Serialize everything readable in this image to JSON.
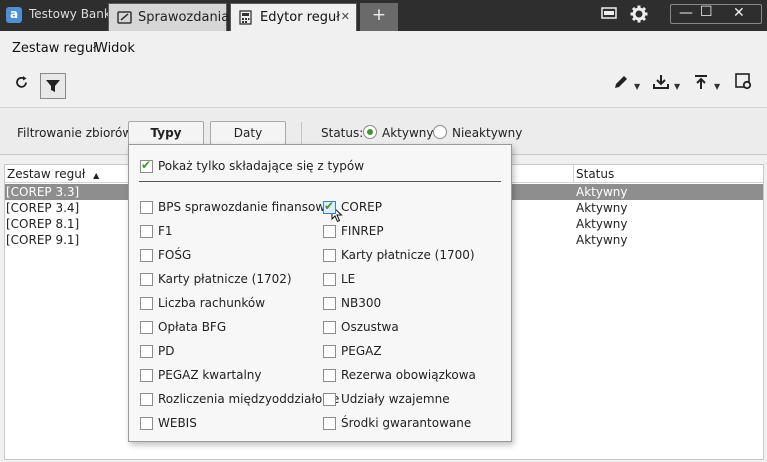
{
  "titlebar": {
    "app_name": "Testowy Bank",
    "tabs": [
      {
        "label": "Sprawozdania",
        "icon": "briefcase-icon"
      },
      {
        "label": "Edytor reguł",
        "icon": "calculator-icon",
        "close": "✕"
      }
    ],
    "add_tab": "+",
    "window_controls": {
      "minimize": "—",
      "maximize": "☐",
      "close": "✕"
    }
  },
  "menu": {
    "items": [
      "Zestaw reguł",
      "Widok"
    ]
  },
  "filterbar": {
    "label": "Filtrowanie zbiorów",
    "btn_types": "Typy",
    "btn_dates": "Daty",
    "status_label": "Status:",
    "status_active": "Aktywny",
    "status_inactive": "Nieaktywny",
    "status_selected": "Aktywny"
  },
  "table": {
    "headers": {
      "ruleset": "Zestaw reguł",
      "status": "Status"
    },
    "sort_indicator": "▲",
    "rows": [
      {
        "ruleset": "[COREP 3.3]",
        "status": "Aktywny",
        "selected": true
      },
      {
        "ruleset": "[COREP 3.4]",
        "status": "Aktywny",
        "selected": false
      },
      {
        "ruleset": "[COREP 8.1]",
        "status": "Aktywny",
        "selected": false
      },
      {
        "ruleset": "[COREP 9.1]",
        "status": "Aktywny",
        "selected": false
      }
    ]
  },
  "popup": {
    "only_composing_label": "Pokaż tylko składające się z typów",
    "only_composing_checked": true,
    "left_items": [
      "BPS sprawozdanie finansowe",
      "F1",
      "FOŚG",
      "Karty płatnicze (1702)",
      "Liczba rachunków",
      "Opłata BFG",
      "PD",
      "PEGAZ kwartalny",
      "Rozliczenia międzyoddziałowe",
      "WEBIS"
    ],
    "right_items": [
      "COREP",
      "FINREP",
      "Karty płatnicze (1700)",
      "LE",
      "NB300",
      "Oszustwa",
      "PEGAZ",
      "Rezerwa obowiązkowa",
      "Udziały wzajemne",
      "Środki gwarantowane"
    ],
    "checked_items": [
      "COREP"
    ]
  },
  "colors": {
    "accent_green": "#3c9a2a",
    "selected_row": "#8e8e8e"
  }
}
